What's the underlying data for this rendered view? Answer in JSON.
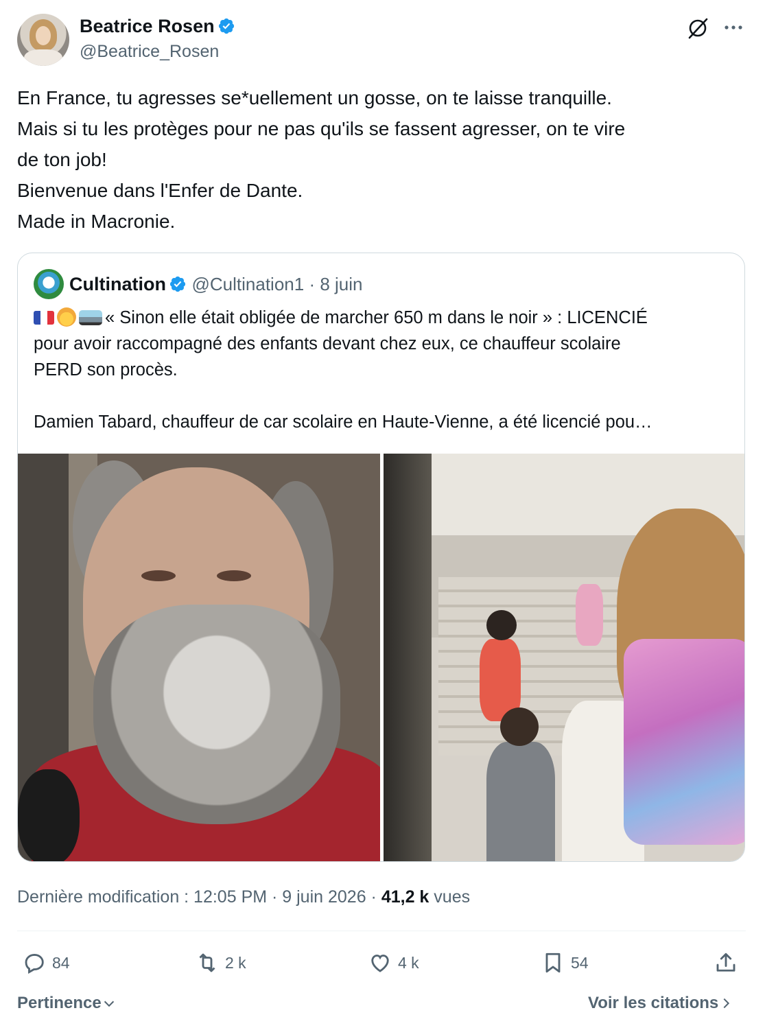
{
  "author": {
    "name": "Beatrice Rosen",
    "handle": "@Beatrice_Rosen",
    "verified_icon": "verified-badge-icon",
    "accent": "#1d9bf0"
  },
  "header_icons": [
    "grok-icon",
    "more-icon"
  ],
  "tweet": {
    "lines": [
      "En France, tu agresses se*uellement un gosse, on te laisse tranquille.",
      "Mais si tu les protèges pour ne pas qu'ils se fassent agresser, on te vire",
      "de ton job!",
      "Bienvenue dans l'Enfer de Dante.",
      "Made in Macronie."
    ]
  },
  "quote": {
    "name": "Cultination",
    "handle": "@Cultination1",
    "separator": " · ",
    "date": "8 juin",
    "emoji_icons": [
      "france-flag-icon",
      "person-icon",
      "bus-icon"
    ],
    "lines": [
      "« Sinon elle était obligée de marcher 650 m dans le noir » : LICENCIÉ",
      "pour avoir raccompagné des enfants devant chez eux, ce chauffeur scolaire",
      "PERD son procès.",
      "",
      "Damien Tabard, chauffeur de car scolaire en Haute-Vienne, a été licencié pou…"
    ]
  },
  "meta": {
    "prefix": "Dernière modification : 12:05 PM · 9 juin 2026 · ",
    "views_count": "41,2 k",
    "views_label": " vues"
  },
  "actions": {
    "replies": "84",
    "reposts": "2 k",
    "likes": "4 k",
    "bookmarks": "54"
  },
  "footer": {
    "sort_label": "Pertinence",
    "quotes_link": "Voir les citations"
  }
}
